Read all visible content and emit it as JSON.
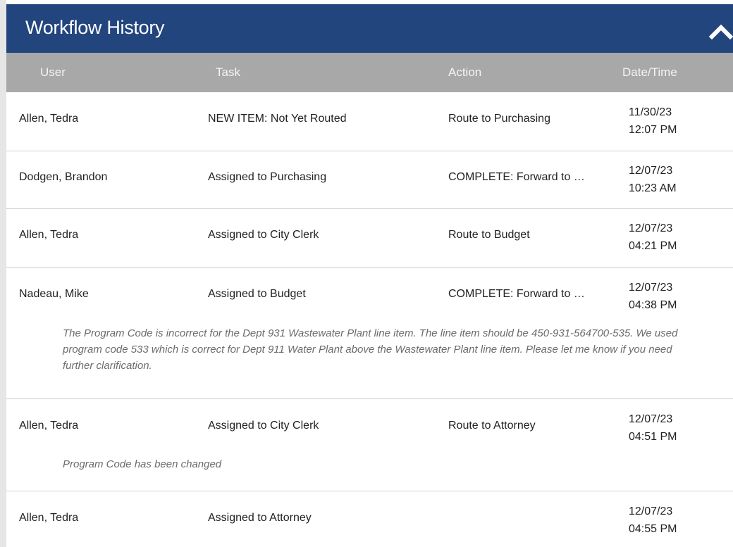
{
  "header": {
    "title": "Workflow History"
  },
  "columns": {
    "user": "User",
    "task": "Task",
    "action": "Action",
    "datetime": "Date/Time"
  },
  "rows": [
    {
      "user": "Allen, Tedra",
      "task": "NEW ITEM: Not Yet Routed",
      "action": "Route to Purchasing",
      "date": "11/30/23",
      "time": "12:07 PM",
      "comment": ""
    },
    {
      "user": "Dodgen, Brandon",
      "task": "Assigned to Purchasing",
      "action": "COMPLETE: Forward to …",
      "date": "12/07/23",
      "time": "10:23 AM",
      "comment": ""
    },
    {
      "user": "Allen, Tedra",
      "task": "Assigned to City Clerk",
      "action": "Route to Budget",
      "date": "12/07/23",
      "time": "04:21 PM",
      "comment": ""
    },
    {
      "user": "Nadeau, Mike",
      "task": "Assigned to Budget",
      "action": "COMPLETE: Forward to …",
      "date": "12/07/23",
      "time": "04:38 PM",
      "comment": "The Program Code is incorrect for the Dept 931 Wastewater Plant line item. The line item should be 450-931-564700-535. We used program code 533 which is correct for Dept 911 Water Plant above the Wastewater Plant line item. Please let me know if you need further clarification."
    },
    {
      "user": "Allen, Tedra",
      "task": "Assigned to City Clerk",
      "action": "Route to Attorney",
      "date": "12/07/23",
      "time": "04:51 PM",
      "comment": "Program Code has been changed"
    },
    {
      "user": "Allen, Tedra",
      "task": "Assigned to Attorney",
      "action": "",
      "date": "12/07/23",
      "time": "04:55 PM",
      "comment": ""
    }
  ],
  "icons": {
    "collapse": "chevron-up-icon"
  },
  "colors": {
    "header": "#22457e",
    "column_header": "#a8a8a8",
    "divider": "#cfcfcf"
  }
}
